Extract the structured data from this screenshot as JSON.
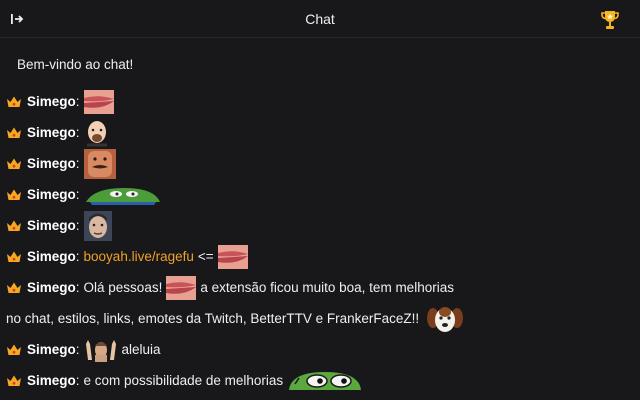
{
  "header": {
    "title": "Chat",
    "collapse_icon": "arrow-right-to-bar-icon",
    "trophy_icon": "trophy-icon"
  },
  "welcome": "Bem-vindo ao chat!",
  "colors": {
    "background": "#18181b",
    "link": "#f0a028",
    "crown": "#f7a823"
  },
  "messages": [
    {
      "user": "Simego",
      "colon": ":",
      "emote": "lips-emote"
    },
    {
      "user": "Simego",
      "colon": ":",
      "emote": "bald-guy-emote"
    },
    {
      "user": "Simego",
      "colon": ":",
      "emote": "mustache-face-emote"
    },
    {
      "user": "Simego",
      "colon": ":",
      "emote": "pepe-frog-emote"
    },
    {
      "user": "Simego",
      "colon": ":",
      "emote": "man-face-emote"
    },
    {
      "user": "Simego",
      "colon": ":",
      "link": "booyah.live/ragefu",
      "text_after": "<=",
      "emote": "lips-emote"
    },
    {
      "user": "Simego",
      "colon": ":",
      "text_1": "Olá pessoas!",
      "text_2": "a extensão ficou muito boa, tem melhorias",
      "text_3": "no chat, estilos, links, emotes da Twitch, BetterTTV e FrankerFaceZ!!",
      "emote_1": "lips-emote",
      "emote_2": "dog-emote"
    },
    {
      "user": "Simego",
      "colon": ":",
      "emote": "praise-hands-emote",
      "text": "aleluia"
    },
    {
      "user": "Simego",
      "colon": ":",
      "text": "e com possibilidade de melhorias",
      "emote": "pepe-eyes-emote"
    }
  ]
}
